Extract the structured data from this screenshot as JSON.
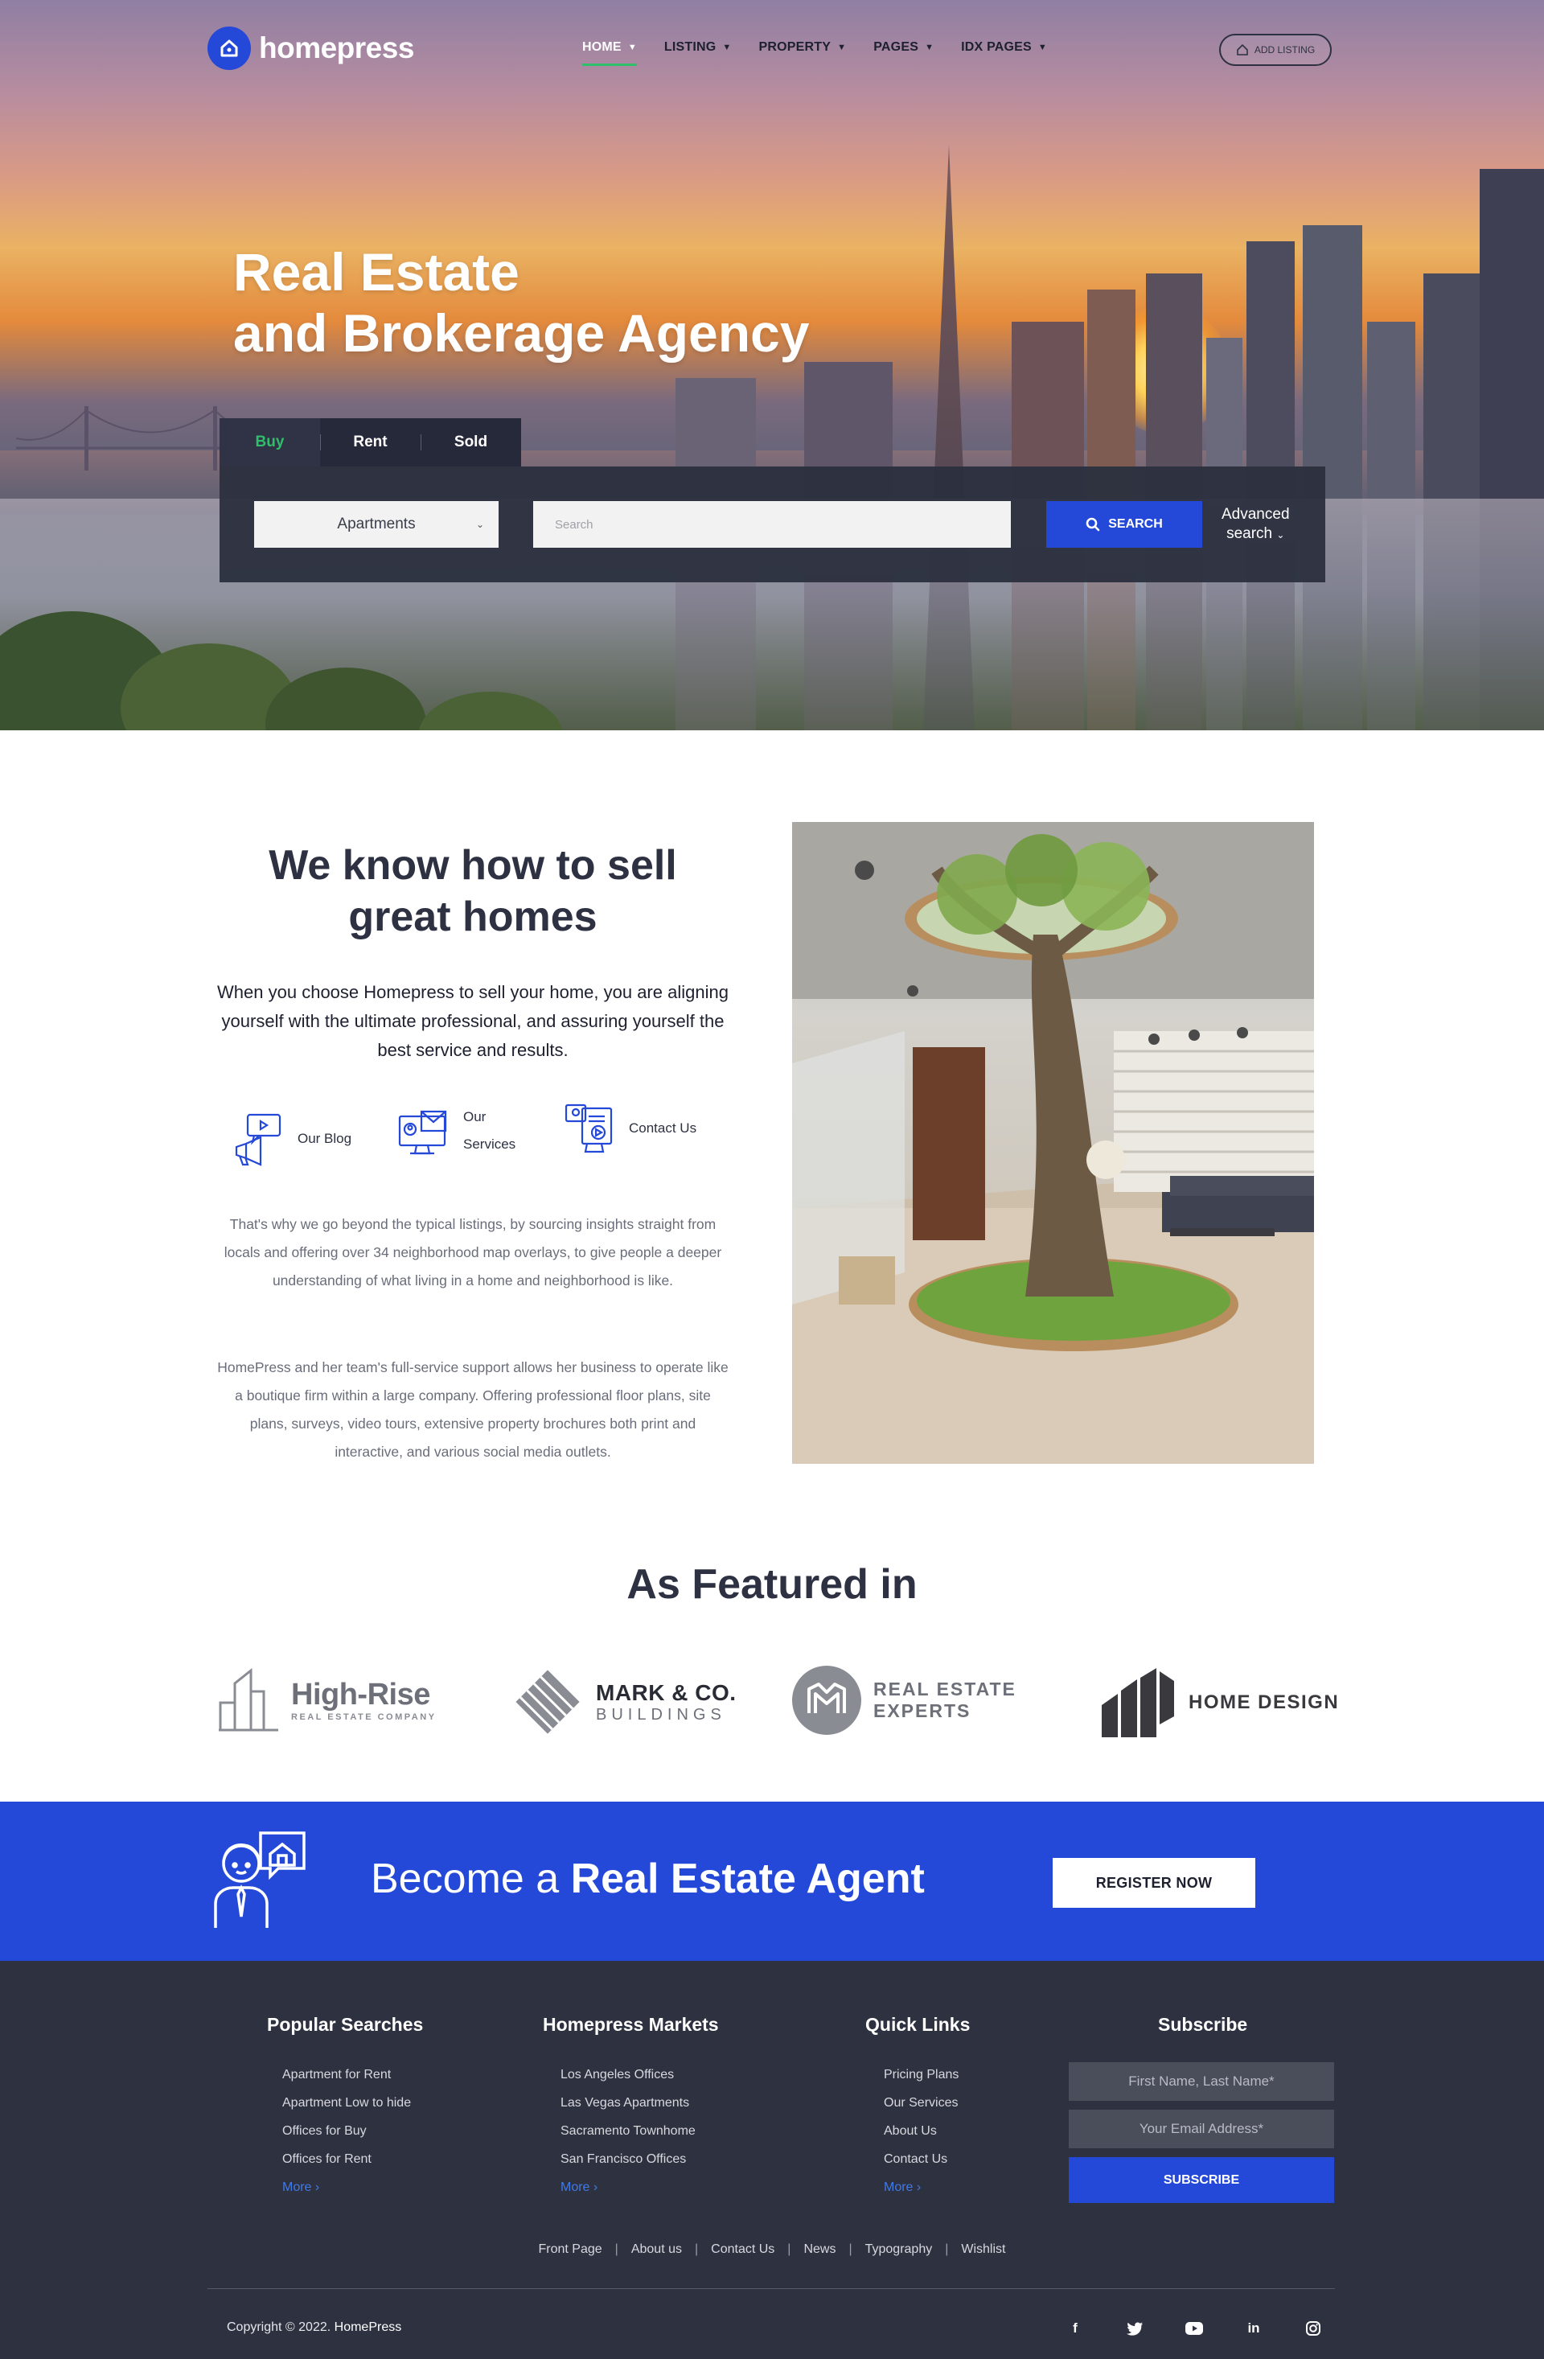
{
  "brand": {
    "name": "homepress",
    "accent": "#2448d8",
    "green": "#2fbe6a"
  },
  "nav": {
    "items": [
      {
        "label": "HOME",
        "active": true
      },
      {
        "label": "LISTING"
      },
      {
        "label": "PROPERTY"
      },
      {
        "label": "PAGES"
      },
      {
        "label": "IDX PAGES"
      }
    ],
    "add_listing": "ADD LISTING"
  },
  "hero": {
    "title_line1": "Real Estate",
    "title_line2": "and Brokerage Agency",
    "tabs": [
      "Buy",
      "Rent",
      "Sold"
    ],
    "property_type": "Apartments",
    "search_placeholder": "Search",
    "search_button": "SEARCH",
    "advanced_line1": "Advanced",
    "advanced_line2": "search"
  },
  "about": {
    "title_line1": "We know how to sell",
    "title_line2": "great homes",
    "lead": "When you choose Homepress to sell your home, you are aligning yourself with the ultimate professional, and assuring yourself the best service and results.",
    "features": [
      {
        "label": "Our Blog",
        "icon": "megaphone-icon"
      },
      {
        "label_line1": "Our",
        "label_line2": "Services",
        "icon": "monitor-icon"
      },
      {
        "label": "Contact Us",
        "icon": "contact-card-icon"
      }
    ],
    "paragraph1": "That's why we go beyond the typical listings, by sourcing insights straight from locals and offering over 34 neighborhood map overlays, to give people a deeper understanding of what living in a home and neighborhood is like.",
    "paragraph2": "HomePress and her team's full-service support allows her business to operate like a boutique firm within a large company. Offering professional floor plans, site plans, surveys, video tours, extensive property brochures both print and interactive, and various social media outlets."
  },
  "featured": {
    "title": "As Featured in",
    "brands": [
      {
        "name": "High-Rise",
        "tagline": "REAL ESTATE COMPANY"
      },
      {
        "name": "MARK & CO.",
        "tagline": "BUILDINGS"
      },
      {
        "name": "REAL ESTATE",
        "tagline": "EXPERTS"
      },
      {
        "name": "HOME DESIGN",
        "tagline": ""
      }
    ]
  },
  "cta": {
    "text_normal": "Become a ",
    "text_bold": "Real Estate Agent",
    "button": "REGISTER NOW"
  },
  "footer": {
    "columns": [
      {
        "title": "Popular Searches",
        "links": [
          "Apartment for Rent",
          "Apartment Low to hide",
          "Offices for Buy",
          "Offices for Rent"
        ],
        "more": "More ›"
      },
      {
        "title": "Homepress Markets",
        "links": [
          "Los Angeles Offices",
          "Las Vegas Apartments",
          "Sacramento Townhome",
          "San Francisco Offices"
        ],
        "more": "More ›"
      },
      {
        "title": "Quick Links",
        "links": [
          "Pricing Plans",
          "Our Services",
          "About Us",
          "Contact Us"
        ],
        "more": "More ›"
      }
    ],
    "subscribe": {
      "title": "Subscribe",
      "name_placeholder": "First Name, Last Name*",
      "email_placeholder": "Your Email Address*",
      "button": "SUBSCRIBE"
    },
    "bottom_nav": [
      "Front Page",
      "About us",
      "Contact Us",
      "News",
      "Typography",
      "Wishlist"
    ],
    "copyright_prefix": "Copyright © 2022. ",
    "copyright_brand": "HomePress",
    "social": [
      {
        "icon": "facebook-icon",
        "glyph": "f"
      },
      {
        "icon": "twitter-icon",
        "glyph": "🐦"
      },
      {
        "icon": "youtube-icon",
        "glyph": "▶"
      },
      {
        "icon": "linkedin-icon",
        "glyph": "in"
      },
      {
        "icon": "instagram-icon",
        "glyph": "◎"
      }
    ]
  }
}
